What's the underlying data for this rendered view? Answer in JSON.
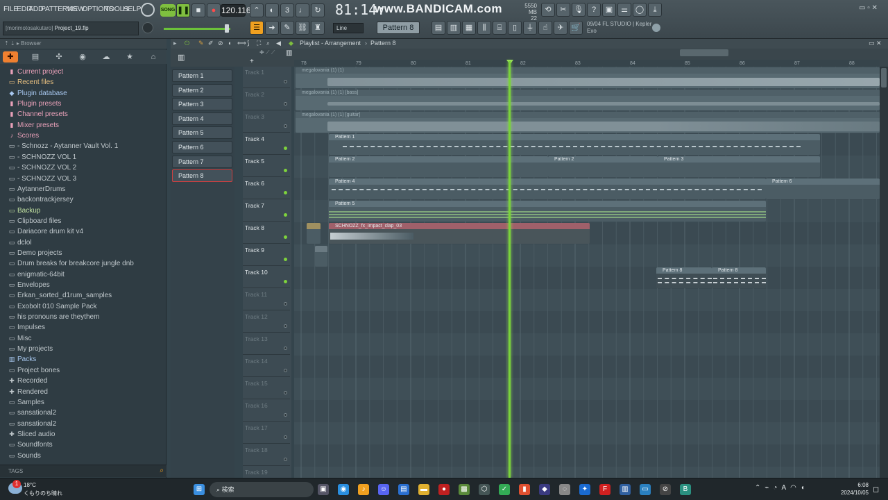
{
  "menu": [
    "FILE",
    "EDIT",
    "ADD",
    "PATTERNS",
    "VIEW",
    "OPTIONS",
    "TOOLS",
    "HELP"
  ],
  "transport": {
    "mode": "SONG",
    "tempo": "120.116",
    "time": "81:14:",
    "overlay": "www.BANDICAM.com",
    "memory": "5550 MB",
    "cpu": "22"
  },
  "hint": {
    "user": "[morimotosakutaro]",
    "project": "Project_19.flp"
  },
  "snap": "Line",
  "pattern_selector": "Pattern 8",
  "news": {
    "line1": "09/04  FL STUDIO | Kepler",
    "line2": "Exo"
  },
  "browser": {
    "title": "Browser",
    "tags_label": "TAGS",
    "items": [
      {
        "label": "Current project",
        "icon": "project-icon",
        "color": "#e8a0b8"
      },
      {
        "label": "Recent files",
        "icon": "folder-icon",
        "color": "#e8c080"
      },
      {
        "label": "Plugin database",
        "icon": "plug-icon",
        "color": "#a8c8f0"
      },
      {
        "label": "Plugin presets",
        "icon": "preset-icon",
        "color": "#e8a0b8"
      },
      {
        "label": "Channel presets",
        "icon": "preset-icon",
        "color": "#e8a0b8"
      },
      {
        "label": "Mixer presets",
        "icon": "preset-icon",
        "color": "#e8a0b8"
      },
      {
        "label": "Scores",
        "icon": "note-icon",
        "color": "#e8a0b8"
      },
      {
        "label": "- Schnozz - Aytanner Vault Vol. 1",
        "icon": "folder-icon",
        "color": "#c0c8cc"
      },
      {
        "label": "- SCHNOZZ VOL 1",
        "icon": "folder-icon",
        "color": "#c0c8cc"
      },
      {
        "label": "- SCHNOZZ VOL 2",
        "icon": "folder-icon",
        "color": "#c0c8cc"
      },
      {
        "label": "- SCHNOZZ VOL 3",
        "icon": "folder-icon",
        "color": "#c0c8cc"
      },
      {
        "label": "AytannerDrums",
        "icon": "folder-icon",
        "color": "#c0c8cc"
      },
      {
        "label": "backontrackjersey",
        "icon": "folder-icon",
        "color": "#c0c8cc"
      },
      {
        "label": "Backup",
        "icon": "folder-icon",
        "color": "#c0e0a0"
      },
      {
        "label": "Clipboard files",
        "icon": "folder-icon",
        "color": "#c0c8cc"
      },
      {
        "label": "Dariacore drum kit v4",
        "icon": "folder-icon",
        "color": "#c0c8cc"
      },
      {
        "label": "dclol",
        "icon": "folder-icon",
        "color": "#c0c8cc"
      },
      {
        "label": "Demo projects",
        "icon": "folder-icon",
        "color": "#c0c8cc"
      },
      {
        "label": "Drum breaks for breakcore jungle dnb",
        "icon": "folder-icon",
        "color": "#c0c8cc"
      },
      {
        "label": "enigmatic-64bit",
        "icon": "folder-icon",
        "color": "#c0c8cc"
      },
      {
        "label": "Envelopes",
        "icon": "folder-icon",
        "color": "#c0c8cc"
      },
      {
        "label": "Erkan_sorted_d1rum_samples",
        "icon": "folder-icon",
        "color": "#c0c8cc"
      },
      {
        "label": "Exobolt 010 Sample Pack",
        "icon": "folder-icon",
        "color": "#c0c8cc"
      },
      {
        "label": "his pronouns are theythem",
        "icon": "folder-icon",
        "color": "#c0c8cc"
      },
      {
        "label": "Impulses",
        "icon": "folder-icon",
        "color": "#c0c8cc"
      },
      {
        "label": "Misc",
        "icon": "folder-icon",
        "color": "#c0c8cc"
      },
      {
        "label": "My projects",
        "icon": "folder-icon",
        "color": "#c0c8cc"
      },
      {
        "label": "Packs",
        "icon": "pack-icon",
        "color": "#a8c8f0"
      },
      {
        "label": "Project bones",
        "icon": "folder-icon",
        "color": "#c0c8cc"
      },
      {
        "label": "Recorded",
        "icon": "plus-icon",
        "color": "#c0c8cc"
      },
      {
        "label": "Rendered",
        "icon": "plus-icon",
        "color": "#c0c8cc"
      },
      {
        "label": "Samples",
        "icon": "folder-icon",
        "color": "#c0c8cc"
      },
      {
        "label": "sansational2",
        "icon": "folder-icon",
        "color": "#c0c8cc"
      },
      {
        "label": "sansational2",
        "icon": "folder-icon",
        "color": "#c0c8cc"
      },
      {
        "label": "Sliced audio",
        "icon": "plus-icon",
        "color": "#c0c8cc"
      },
      {
        "label": "Soundfonts",
        "icon": "folder-icon",
        "color": "#c0c8cc"
      },
      {
        "label": "Sounds",
        "icon": "folder-icon",
        "color": "#c0c8cc"
      }
    ]
  },
  "playlist": {
    "title": "Playlist - Arrangement",
    "pattern": "Pattern 8",
    "ruler": [
      "78",
      "79",
      "80",
      "81",
      "82",
      "83",
      "84",
      "85",
      "86",
      "87",
      "88"
    ],
    "patterns": [
      "Pattern 1",
      "Pattern 2",
      "Pattern 3",
      "Pattern 4",
      "Pattern 5",
      "Pattern 6",
      "Pattern 7",
      "Pattern 8"
    ],
    "tracks": [
      {
        "name": "Track 1",
        "active": false
      },
      {
        "name": "Track 2",
        "active": false
      },
      {
        "name": "Track 3",
        "active": false
      },
      {
        "name": "Track 4",
        "active": true
      },
      {
        "name": "Track 5",
        "active": true
      },
      {
        "name": "Track 6",
        "active": true
      },
      {
        "name": "Track 7",
        "active": true
      },
      {
        "name": "Track 8",
        "active": true
      },
      {
        "name": "Track 9",
        "active": true
      },
      {
        "name": "Track 10",
        "active": true
      },
      {
        "name": "Track 11",
        "active": false
      },
      {
        "name": "Track 12",
        "active": false
      },
      {
        "name": "Track 13",
        "active": false
      },
      {
        "name": "Track 14",
        "active": false
      },
      {
        "name": "Track 15",
        "active": false
      },
      {
        "name": "Track 16",
        "active": false
      },
      {
        "name": "Track 17",
        "active": false
      },
      {
        "name": "Track 18",
        "active": false
      },
      {
        "name": "Track 19",
        "active": false
      }
    ],
    "clips": {
      "audio1": "megalovania (1) (1)",
      "audio2": "megalovania (1) (1) [bass]",
      "audio3": "megalovania (1) (1) [guitar]",
      "p1": "Pattern 1",
      "p2": "Pattern 2",
      "p2b": "Pattern 2",
      "p3": "Pattern 3",
      "p4": "Pattern 4",
      "p6": "Pattern 6",
      "p5": "Pattern 5",
      "clap": "SCHNOZZ_fx_impact_clap_03",
      "p8a": "Pattern 8",
      "p8b": "Pattern 8"
    }
  },
  "taskbar": {
    "weather_temp": "18°C",
    "weather_desc": "くもりのち晴れ",
    "search": "検索",
    "time": "6:08",
    "date": "2024/10/05",
    "notif": "1"
  }
}
